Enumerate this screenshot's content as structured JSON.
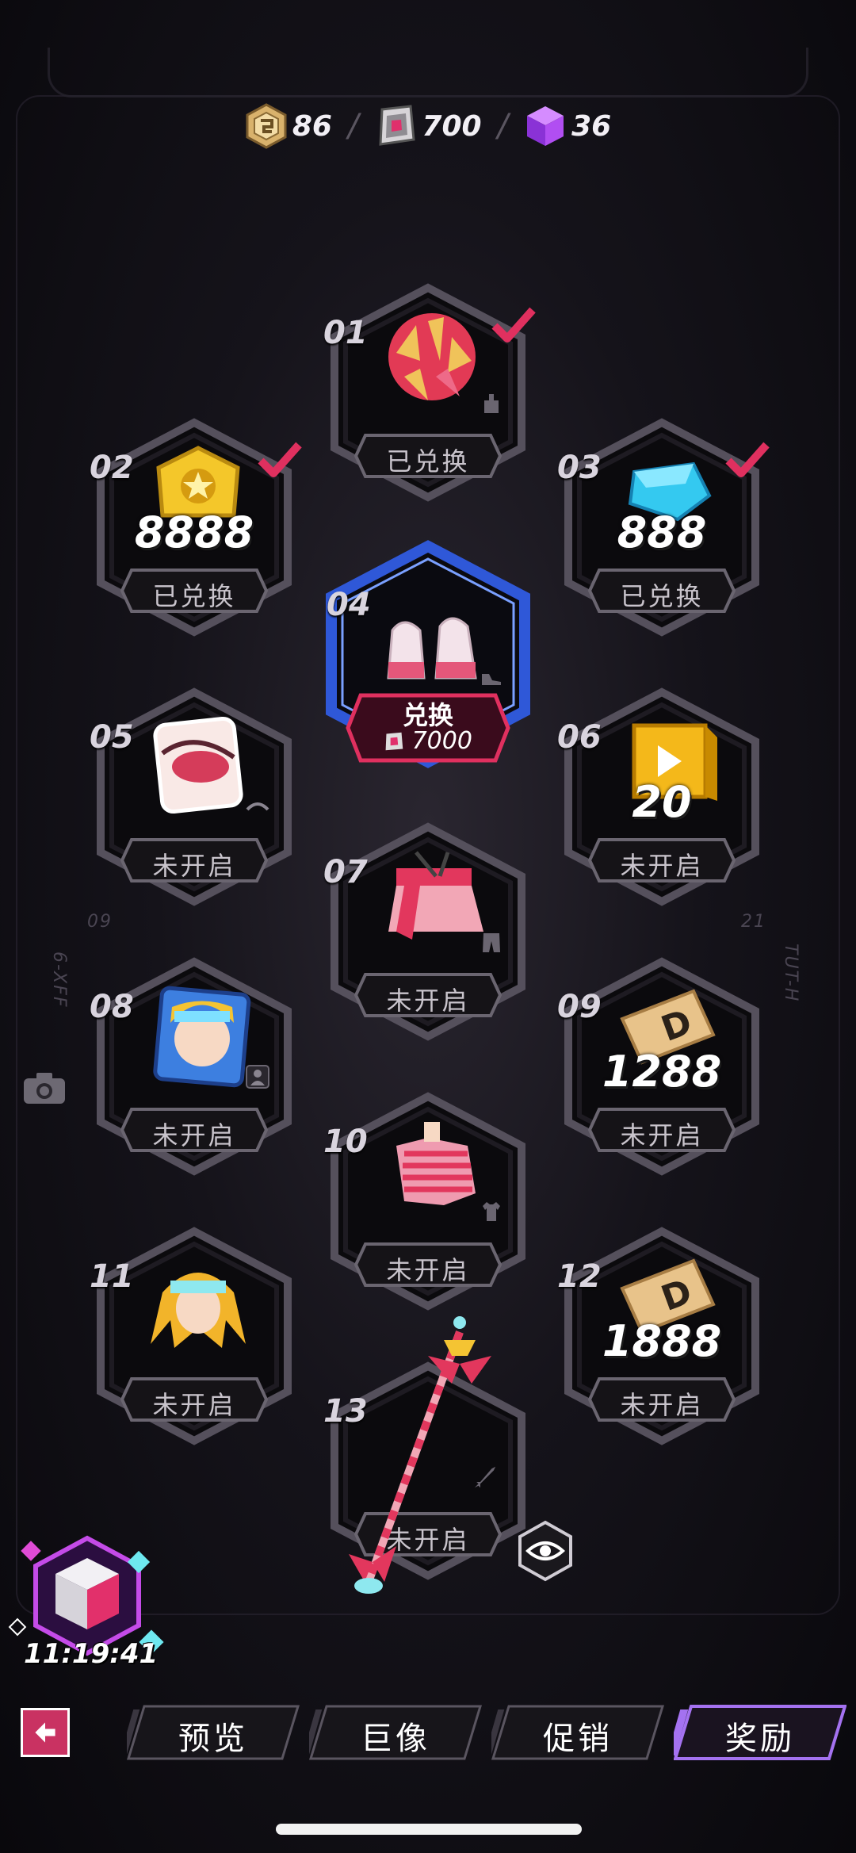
{
  "currencies": [
    {
      "icon": "gold-coin-icon",
      "value": "86"
    },
    {
      "icon": "pink-gem-icon",
      "value": "700"
    },
    {
      "icon": "purple-cube-icon",
      "value": "36"
    }
  ],
  "currency_separator": "/",
  "side_labels": {
    "left": "6-XFF",
    "right": "TUT-H",
    "left_num": "09",
    "right_num": "21"
  },
  "slots": [
    {
      "number": "01",
      "status": "已兑换",
      "claimed": true,
      "item": "pompom-hair",
      "type_icon": "glove-icon"
    },
    {
      "number": "02",
      "status": "已兑换",
      "claimed": true,
      "item": "gold-coin",
      "amount": "8888"
    },
    {
      "number": "03",
      "status": "已兑换",
      "claimed": true,
      "item": "blue-diamond",
      "amount": "888"
    },
    {
      "number": "04",
      "redeem_label": "兑换",
      "cost": "7000",
      "item": "sneakers",
      "type_icon": "shoe-icon"
    },
    {
      "number": "05",
      "status": "未开启",
      "item": "eyeshadow",
      "type_icon": "eye-icon"
    },
    {
      "number": "06",
      "status": "未开启",
      "item": "video-ticket",
      "amount": "20"
    },
    {
      "number": "07",
      "status": "未开启",
      "item": "skirt",
      "type_icon": "pants-icon"
    },
    {
      "number": "08",
      "status": "未开启",
      "item": "avatar-frame",
      "type_icon": "person-icon"
    },
    {
      "number": "09",
      "status": "未开启",
      "item": "d-ticket",
      "amount": "1288"
    },
    {
      "number": "10",
      "status": "未开启",
      "item": "top",
      "type_icon": "shirt-icon"
    },
    {
      "number": "11",
      "status": "未开启",
      "item": "hair-visor",
      "type_icon": "hair-icon"
    },
    {
      "number": "12",
      "status": "未开启",
      "item": "d-ticket",
      "amount": "1888"
    },
    {
      "number": "13",
      "status": "未开启",
      "item": "magic-staff",
      "type_icon": "sword-icon"
    }
  ],
  "timer": "11:19:41",
  "tabs": [
    {
      "label": "预览",
      "active": false
    },
    {
      "label": "巨像",
      "active": false
    },
    {
      "label": "促销",
      "active": false
    },
    {
      "label": "奖励",
      "active": true
    }
  ],
  "colors": {
    "accent_pink": "#d8325f",
    "accent_blue": "#3c66e8",
    "tab_active": "#a472f0"
  }
}
